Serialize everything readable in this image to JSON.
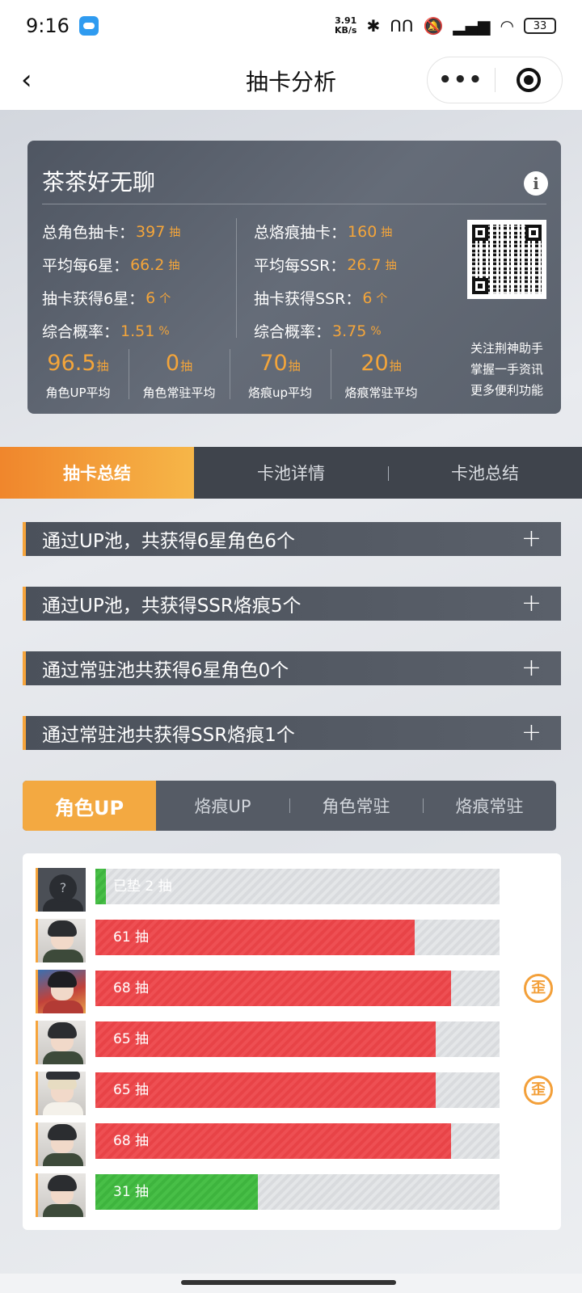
{
  "status": {
    "time": "9:16",
    "speed_top": "3.91",
    "speed_bottom": "KB/s",
    "battery": "33"
  },
  "nav": {
    "title": "抽卡分析",
    "back": "‹",
    "more": "•••"
  },
  "card": {
    "username": "茶茶好无聊",
    "info": "i",
    "left_stats": [
      {
        "label": "总角色抽卡：",
        "value": "397",
        "unit": "抽"
      },
      {
        "label": "平均每6星：",
        "value": "66.2",
        "unit": "抽"
      },
      {
        "label": "抽卡获得6星：",
        "value": "6",
        "unit": "个"
      },
      {
        "label": "综合概率：",
        "value": "1.51",
        "unit": "%"
      }
    ],
    "right_stats": [
      {
        "label": "总烙痕抽卡：",
        "value": "160",
        "unit": "抽"
      },
      {
        "label": "平均每SSR：",
        "value": "26.7",
        "unit": "抽"
      },
      {
        "label": "抽卡获得SSR：",
        "value": "6",
        "unit": "个"
      },
      {
        "label": "综合概率：",
        "value": "3.75",
        "unit": "%"
      }
    ],
    "averages": [
      {
        "value": "96.5",
        "unit": "抽",
        "label": "角色UP平均"
      },
      {
        "value": "0",
        "unit": "抽",
        "label": "角色常驻平均"
      },
      {
        "value": "70",
        "unit": "抽",
        "label": "烙痕up平均"
      },
      {
        "value": "20",
        "unit": "抽",
        "label": "烙痕常驻平均"
      }
    ],
    "follow": [
      "关注荆神助手",
      "掌握一手资讯",
      "更多便利功能"
    ]
  },
  "tabs": [
    "抽卡总结",
    "卡池详情",
    "卡池总结"
  ],
  "accordions": [
    "通过UP池，共获得6星角色6个",
    "通过UP池，共获得SSR烙痕5个",
    "通过常驻池共获得6星角色0个",
    "通过常驻池共获得SSR烙痕1个"
  ],
  "plus": "+",
  "subtabs": [
    "角色UP",
    "烙痕UP",
    "角色常驻",
    "烙痕常驻"
  ],
  "pulls": [
    {
      "label": "已垫 2 抽",
      "fraction": 0.026,
      "color": "#3eb43e",
      "badge": "",
      "avatar": "mystery"
    },
    {
      "label": "61 抽",
      "fraction": 0.79,
      "color": "#e84347",
      "badge": "",
      "avatar": "dark"
    },
    {
      "label": "68 抽",
      "fraction": 0.88,
      "color": "#e84347",
      "badge": "歪",
      "avatar": "red"
    },
    {
      "label": "65 抽",
      "fraction": 0.842,
      "color": "#e84347",
      "badge": "",
      "avatar": "dark"
    },
    {
      "label": "65 抽",
      "fraction": 0.842,
      "color": "#e84347",
      "badge": "歪",
      "avatar": "white"
    },
    {
      "label": "68 抽",
      "fraction": 0.88,
      "color": "#e84347",
      "badge": "",
      "avatar": "dark"
    },
    {
      "label": "31 抽",
      "fraction": 0.402,
      "color": "#3eb43e",
      "badge": "",
      "avatar": "dark"
    }
  ],
  "mystery_mark": "?",
  "colors": {
    "accent": "#f6a43b",
    "card": "#5a616c",
    "red": "#e84347",
    "green": "#3eb43e"
  }
}
